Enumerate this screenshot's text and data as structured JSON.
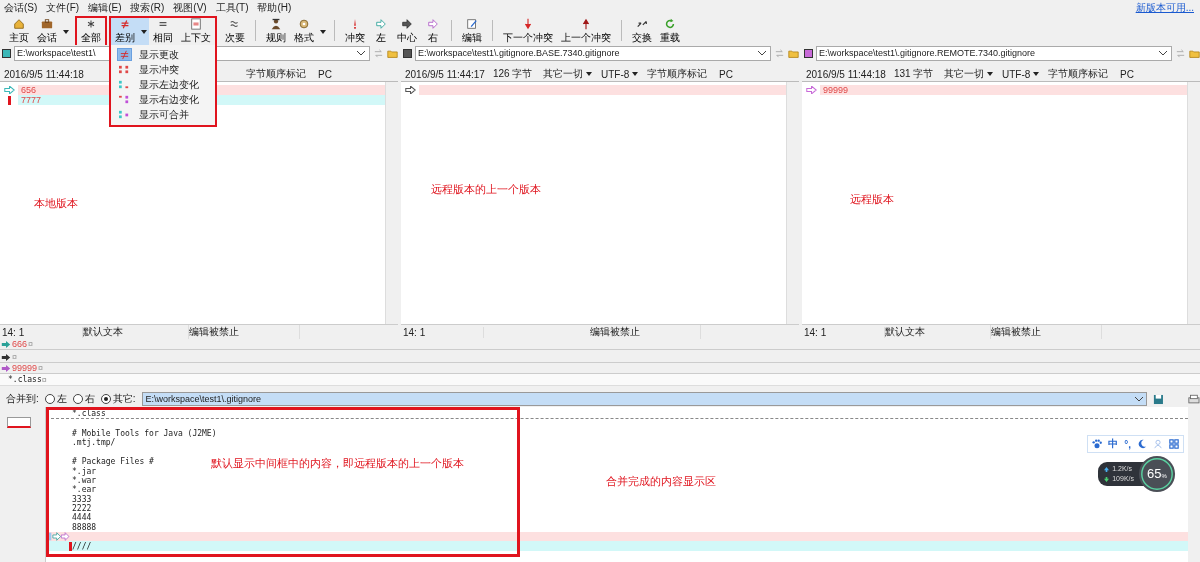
{
  "menu": [
    {
      "label": "会话(S)"
    },
    {
      "label": "文件(F)"
    },
    {
      "label": "编辑(E)"
    },
    {
      "label": "搜索(R)"
    },
    {
      "label": "视图(V)"
    },
    {
      "label": "工具(T)"
    },
    {
      "label": "帮助(H)"
    }
  ],
  "update_link": "新版本可用...",
  "toolbar_groups": [
    {
      "highlighted": false,
      "buttons": [
        {
          "label": "主页",
          "selected": false,
          "dropdown": false
        },
        {
          "label": "会话",
          "selected": false,
          "dropdown": true
        }
      ]
    },
    {
      "highlighted": true,
      "buttons": [
        {
          "label": "全部",
          "selected": false,
          "dropdown": false
        }
      ]
    },
    {
      "highlighted": true,
      "buttons": [
        {
          "label": "差别",
          "selected": true,
          "dropdown": true
        },
        {
          "label": "相同",
          "selected": false,
          "dropdown": false
        },
        {
          "label": "上下文",
          "selected": false,
          "dropdown": false
        }
      ],
      "menu": [
        {
          "label": "显示更改",
          "selected": true
        },
        {
          "label": "显示冲突",
          "selected": false
        },
        {
          "label": "显示左边变化",
          "selected": false
        },
        {
          "label": "显示右边变化",
          "selected": false
        },
        {
          "label": "显示可合并",
          "selected": false
        }
      ]
    },
    {
      "highlighted": false,
      "buttons": [
        {
          "label": "次要",
          "selected": false,
          "dropdown": false
        }
      ]
    },
    {
      "highlighted": false,
      "buttons": [
        {
          "label": "规则",
          "selected": false,
          "dropdown": false
        },
        {
          "label": "格式",
          "selected": false,
          "dropdown": true
        }
      ]
    },
    {
      "highlighted": false,
      "buttons": [
        {
          "label": "冲突",
          "selected": false,
          "dropdown": false
        },
        {
          "label": "左",
          "selected": false,
          "dropdown": false
        },
        {
          "label": "中心",
          "selected": false,
          "dropdown": false
        },
        {
          "label": "右",
          "selected": false,
          "dropdown": false
        }
      ]
    },
    {
      "highlighted": false,
      "buttons": [
        {
          "label": "编辑",
          "selected": false,
          "dropdown": false
        }
      ]
    },
    {
      "highlighted": false,
      "buttons": [
        {
          "label": "下一个冲突",
          "selected": false,
          "dropdown": false
        },
        {
          "label": "上一个冲突",
          "selected": false,
          "dropdown": false
        }
      ]
    },
    {
      "highlighted": false,
      "buttons": [
        {
          "label": "交换",
          "selected": false,
          "dropdown": false
        },
        {
          "label": "重载",
          "selected": false,
          "dropdown": false
        }
      ]
    }
  ],
  "panes": [
    {
      "color": "#3cb8b8",
      "path": "E:\\workspace\\test1\\",
      "info": {
        "date": "2016/9/5 11:44:18",
        "bom": "字节顺序标记",
        "platform": "PC"
      },
      "lines": [
        {
          "text": "656",
          "kind": "conflict"
        },
        {
          "text": "7777",
          "kind": "change"
        }
      ],
      "annotation": "本地版本",
      "status": {
        "position": "14: 1",
        "mode": "默认文本",
        "edit_state": "编辑被禁止"
      }
    },
    {
      "color": "#555555",
      "path": "E:\\workspace\\test1\\.gitignore.BASE.7340.gitignore",
      "info": {
        "date": "2016/9/5 11:44:17",
        "size": "126 字节",
        "eol": "其它一切",
        "encoding": "UTF-8",
        "bom": "字节顺序标记",
        "platform": "PC"
      },
      "lines": [
        {
          "kind": "conflict"
        }
      ],
      "annotation": "远程版本的上一个版本",
      "status": {
        "position": "14: 1",
        "edit_state": "编辑被禁止"
      }
    },
    {
      "color": "#c86ad8",
      "path": "E:\\workspace\\test1\\.gitignore.REMOTE.7340.gitignore",
      "info": {
        "date": "2016/9/5 11:44:18",
        "size": "131 字节",
        "eol": "其它一切",
        "encoding": "UTF-8",
        "bom": "字节顺序标记",
        "platform": "PC"
      },
      "lines": [
        {
          "text": "99999",
          "kind": "conflict"
        }
      ],
      "annotation": "远程版本",
      "status": {
        "position": "14: 1",
        "mode": "默认文本",
        "edit_state": "编辑被禁止"
      }
    }
  ],
  "compare_lines": [
    {
      "text": "666",
      "eol": "¤",
      "color": "#2aa198"
    },
    {
      "eol": "¤",
      "color": "#333333"
    },
    {
      "text": "99999",
      "eol": "¤",
      "color": "#b05ac8"
    }
  ],
  "merged_preview": {
    "text": "*.class",
    "eol": "¤"
  },
  "merge_target": {
    "label": "合并到:",
    "options": [
      {
        "label": "左",
        "selected": false
      },
      {
        "label": "右",
        "selected": false
      },
      {
        "label": "其它:",
        "selected": true
      }
    ],
    "path": "E:\\workspace\\test1\\.gitignore"
  },
  "editor": {
    "highlighted": true,
    "annotation": "默认显示中间框中的内容，即远程版本的上一个版本",
    "lines": [
      {
        "text": "*.class",
        "kind": "plain"
      },
      {
        "kind": "plain"
      },
      {
        "text": "# Mobile Tools for Java (J2ME)",
        "kind": "plain"
      },
      {
        "text": ".mtj.tmp/",
        "kind": "plain"
      },
      {
        "kind": "plain"
      },
      {
        "text": "# Package Files #",
        "kind": "plain"
      },
      {
        "text": "*.jar",
        "kind": "plain"
      },
      {
        "text": "*.war",
        "kind": "plain"
      },
      {
        "text": "*.ear",
        "kind": "plain"
      },
      {
        "text": "3333",
        "kind": "plain"
      },
      {
        "text": "2222",
        "kind": "plain"
      },
      {
        "text": "4444",
        "kind": "plain"
      },
      {
        "text": "88888",
        "kind": "plain"
      },
      {
        "kind": "conflict"
      },
      {
        "text": "////",
        "kind": "change"
      }
    ]
  },
  "result_annotation": "合并完成的内容显示区",
  "ime": {
    "mode": "中",
    "punct": "°,"
  },
  "net_meter": {
    "up": "1.2K/s",
    "down": "109K/s",
    "value": "65",
    "unit": "%"
  }
}
